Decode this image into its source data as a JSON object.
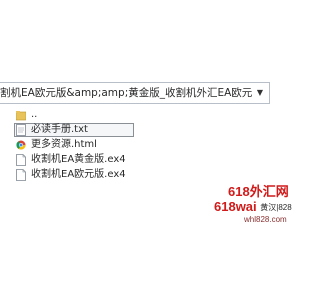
{
  "address_bar": {
    "path": "割机EA欧元版&amp;amp;黄金版_收割机外汇EA欧元版&",
    "dropdown_icon": "chevron-down-icon"
  },
  "files": [
    {
      "name": "..",
      "icon": "folder-up-icon"
    },
    {
      "name": "必读手册.txt",
      "icon": "text-file-icon"
    },
    {
      "name": "更多资源.html",
      "icon": "chrome-html-icon"
    },
    {
      "name": "收割机EA黄金版.ex4",
      "icon": "blank-file-icon"
    },
    {
      "name": "收割机EA欧元版.ex4",
      "icon": "blank-file-icon"
    }
  ],
  "watermark": {
    "line1": "618外汇网",
    "line2_brand": "618wai",
    "line2_cn": "黄汉|828",
    "line3": "whl828.com",
    "color": "#d11a1a"
  }
}
